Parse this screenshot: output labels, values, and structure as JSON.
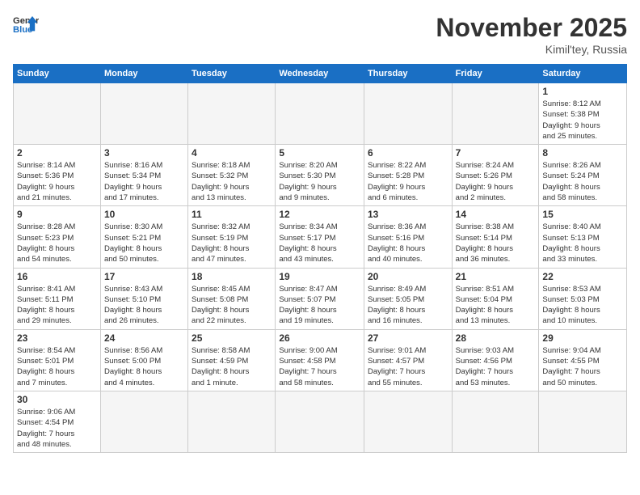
{
  "header": {
    "logo_general": "General",
    "logo_blue": "Blue",
    "title": "November 2025",
    "location": "Kimil'tey, Russia"
  },
  "days_of_week": [
    "Sunday",
    "Monday",
    "Tuesday",
    "Wednesday",
    "Thursday",
    "Friday",
    "Saturday"
  ],
  "weeks": [
    [
      {
        "day": null,
        "info": ""
      },
      {
        "day": null,
        "info": ""
      },
      {
        "day": null,
        "info": ""
      },
      {
        "day": null,
        "info": ""
      },
      {
        "day": null,
        "info": ""
      },
      {
        "day": null,
        "info": ""
      },
      {
        "day": "1",
        "info": "Sunrise: 8:12 AM\nSunset: 5:38 PM\nDaylight: 9 hours\nand 25 minutes."
      }
    ],
    [
      {
        "day": "2",
        "info": "Sunrise: 8:14 AM\nSunset: 5:36 PM\nDaylight: 9 hours\nand 21 minutes."
      },
      {
        "day": "3",
        "info": "Sunrise: 8:16 AM\nSunset: 5:34 PM\nDaylight: 9 hours\nand 17 minutes."
      },
      {
        "day": "4",
        "info": "Sunrise: 8:18 AM\nSunset: 5:32 PM\nDaylight: 9 hours\nand 13 minutes."
      },
      {
        "day": "5",
        "info": "Sunrise: 8:20 AM\nSunset: 5:30 PM\nDaylight: 9 hours\nand 9 minutes."
      },
      {
        "day": "6",
        "info": "Sunrise: 8:22 AM\nSunset: 5:28 PM\nDaylight: 9 hours\nand 6 minutes."
      },
      {
        "day": "7",
        "info": "Sunrise: 8:24 AM\nSunset: 5:26 PM\nDaylight: 9 hours\nand 2 minutes."
      },
      {
        "day": "8",
        "info": "Sunrise: 8:26 AM\nSunset: 5:24 PM\nDaylight: 8 hours\nand 58 minutes."
      }
    ],
    [
      {
        "day": "9",
        "info": "Sunrise: 8:28 AM\nSunset: 5:23 PM\nDaylight: 8 hours\nand 54 minutes."
      },
      {
        "day": "10",
        "info": "Sunrise: 8:30 AM\nSunset: 5:21 PM\nDaylight: 8 hours\nand 50 minutes."
      },
      {
        "day": "11",
        "info": "Sunrise: 8:32 AM\nSunset: 5:19 PM\nDaylight: 8 hours\nand 47 minutes."
      },
      {
        "day": "12",
        "info": "Sunrise: 8:34 AM\nSunset: 5:17 PM\nDaylight: 8 hours\nand 43 minutes."
      },
      {
        "day": "13",
        "info": "Sunrise: 8:36 AM\nSunset: 5:16 PM\nDaylight: 8 hours\nand 40 minutes."
      },
      {
        "day": "14",
        "info": "Sunrise: 8:38 AM\nSunset: 5:14 PM\nDaylight: 8 hours\nand 36 minutes."
      },
      {
        "day": "15",
        "info": "Sunrise: 8:40 AM\nSunset: 5:13 PM\nDaylight: 8 hours\nand 33 minutes."
      }
    ],
    [
      {
        "day": "16",
        "info": "Sunrise: 8:41 AM\nSunset: 5:11 PM\nDaylight: 8 hours\nand 29 minutes."
      },
      {
        "day": "17",
        "info": "Sunrise: 8:43 AM\nSunset: 5:10 PM\nDaylight: 8 hours\nand 26 minutes."
      },
      {
        "day": "18",
        "info": "Sunrise: 8:45 AM\nSunset: 5:08 PM\nDaylight: 8 hours\nand 22 minutes."
      },
      {
        "day": "19",
        "info": "Sunrise: 8:47 AM\nSunset: 5:07 PM\nDaylight: 8 hours\nand 19 minutes."
      },
      {
        "day": "20",
        "info": "Sunrise: 8:49 AM\nSunset: 5:05 PM\nDaylight: 8 hours\nand 16 minutes."
      },
      {
        "day": "21",
        "info": "Sunrise: 8:51 AM\nSunset: 5:04 PM\nDaylight: 8 hours\nand 13 minutes."
      },
      {
        "day": "22",
        "info": "Sunrise: 8:53 AM\nSunset: 5:03 PM\nDaylight: 8 hours\nand 10 minutes."
      }
    ],
    [
      {
        "day": "23",
        "info": "Sunrise: 8:54 AM\nSunset: 5:01 PM\nDaylight: 8 hours\nand 7 minutes."
      },
      {
        "day": "24",
        "info": "Sunrise: 8:56 AM\nSunset: 5:00 PM\nDaylight: 8 hours\nand 4 minutes."
      },
      {
        "day": "25",
        "info": "Sunrise: 8:58 AM\nSunset: 4:59 PM\nDaylight: 8 hours\nand 1 minute."
      },
      {
        "day": "26",
        "info": "Sunrise: 9:00 AM\nSunset: 4:58 PM\nDaylight: 7 hours\nand 58 minutes."
      },
      {
        "day": "27",
        "info": "Sunrise: 9:01 AM\nSunset: 4:57 PM\nDaylight: 7 hours\nand 55 minutes."
      },
      {
        "day": "28",
        "info": "Sunrise: 9:03 AM\nSunset: 4:56 PM\nDaylight: 7 hours\nand 53 minutes."
      },
      {
        "day": "29",
        "info": "Sunrise: 9:04 AM\nSunset: 4:55 PM\nDaylight: 7 hours\nand 50 minutes."
      }
    ],
    [
      {
        "day": "30",
        "info": "Sunrise: 9:06 AM\nSunset: 4:54 PM\nDaylight: 7 hours\nand 48 minutes."
      },
      {
        "day": null,
        "info": ""
      },
      {
        "day": null,
        "info": ""
      },
      {
        "day": null,
        "info": ""
      },
      {
        "day": null,
        "info": ""
      },
      {
        "day": null,
        "info": ""
      },
      {
        "day": null,
        "info": ""
      }
    ]
  ]
}
